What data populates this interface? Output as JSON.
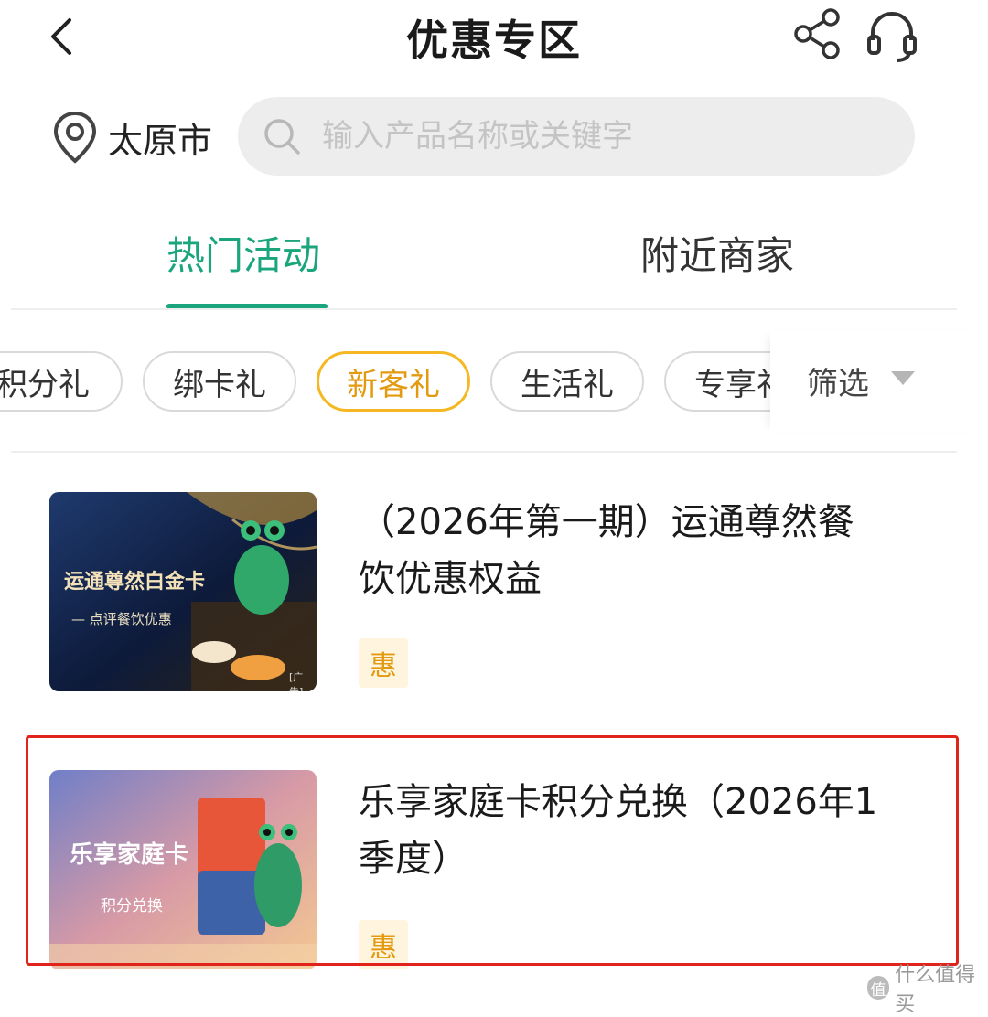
{
  "header": {
    "title": "优惠专区",
    "back_icon": "chevron-left-icon",
    "share_icon": "share-icon",
    "service_icon": "headset-icon"
  },
  "location": {
    "city": "太原市",
    "icon": "location-pin-icon"
  },
  "search": {
    "placeholder": "输入产品名称或关键字",
    "value": "",
    "icon": "search-icon"
  },
  "tabs": [
    {
      "label": "热门活动",
      "active": true
    },
    {
      "label": "附近商家",
      "active": false
    }
  ],
  "filter_chips": [
    {
      "label": "积分礼",
      "active": false
    },
    {
      "label": "绑卡礼",
      "active": false
    },
    {
      "label": "新客礼",
      "active": true
    },
    {
      "label": "生活礼",
      "active": false
    },
    {
      "label": "专享礼",
      "active": false
    }
  ],
  "filter": {
    "label": "筛选",
    "icon": "caret-down-icon"
  },
  "cards": [
    {
      "title_line1": "（2026年第一期）运通尊然餐",
      "title_line2": "饮优惠权益",
      "badge": "惠",
      "image": {
        "headline": "运通尊然白金卡",
        "subline": "— 点评餐饮优惠",
        "tag": "[广告]"
      }
    },
    {
      "title_line1": "乐享家庭卡积分兑换（2026年1",
      "title_line2": "季度）",
      "badge": "惠",
      "highlighted": true,
      "image": {
        "headline": "乐享家庭卡",
        "subline": "积分兑换"
      }
    }
  ],
  "watermark": {
    "logo": "值",
    "text": "什么值得买"
  },
  "colors": {
    "accent_green": "#1aa57c",
    "chip_active": "#f5b822",
    "badge_text": "#e39a10",
    "badge_bg": "#fff5df",
    "highlight_red": "#e0241c"
  }
}
